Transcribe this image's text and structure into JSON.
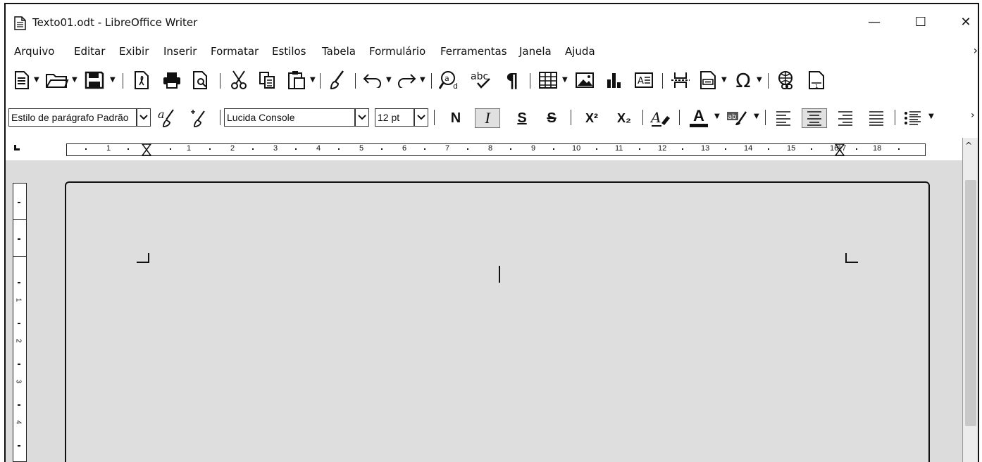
{
  "window": {
    "title": "Texto01.odt - LibreOffice Writer",
    "minimize_glyph": "—",
    "maximize_glyph": "☐",
    "close_glyph": "✕"
  },
  "menu": {
    "items": [
      "Arquivo",
      "Editar",
      "Exibir",
      "Inserir",
      "Formatar",
      "Estilos",
      "Tabela",
      "Formulário",
      "Ferramentas",
      "Janela",
      "Ajuda"
    ],
    "more_glyph": "›"
  },
  "toolbar_standard": {
    "icons": [
      "new-document-icon",
      "open-folder-icon",
      "save-icon",
      "export-pdf-icon",
      "print-icon",
      "print-preview-icon",
      "cut-icon",
      "copy-icon",
      "paste-icon",
      "clone-formatting-icon",
      "undo-icon",
      "redo-icon",
      "find-replace-icon",
      "spellcheck-icon",
      "formatting-marks-icon",
      "insert-table-icon",
      "insert-image-icon",
      "insert-chart-icon",
      "insert-textbox-icon",
      "insert-page-break-icon",
      "insert-field-icon",
      "special-character-icon",
      "hyperlink-icon",
      "footnote-icon"
    ],
    "spellcheck_label": "abc",
    "pilcrow": "¶",
    "omega": "Ω"
  },
  "toolbar_formatting": {
    "paragraph_style": "Estilo de parágrafo Padrão",
    "font_name": "Lucida Console",
    "font_size": "12 pt",
    "bold_label": "N",
    "italic_label": "I",
    "underline_label": "S",
    "strike_label": "S",
    "superscript_label": "X²",
    "subscript_label": "X₂",
    "font_color_label": "A",
    "highlight_label": "ab",
    "italic_active": true,
    "align_center_active": true
  },
  "ruler": {
    "numbers": [
      "1",
      "1",
      "2",
      "3",
      "4",
      "5",
      "6",
      "7",
      "8",
      "9",
      "10",
      "11",
      "12",
      "13",
      "14",
      "15",
      "16",
      "17",
      "18"
    ],
    "vertical_numbers": [
      "1",
      "2",
      "3",
      "4"
    ]
  },
  "scrollbar": {
    "up_glyph": "^"
  }
}
